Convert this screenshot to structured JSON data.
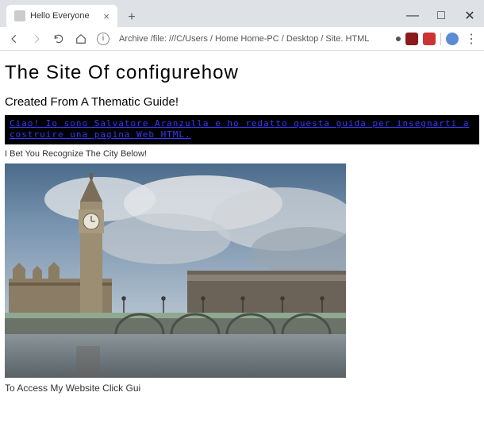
{
  "window": {
    "tab_title": "Hello Everyone",
    "minimize": "—",
    "maximize": "□",
    "close": "✕",
    "newtab": "+",
    "tab_close": "×"
  },
  "toolbar": {
    "info": "i",
    "address": "Archive /file: ///C/Users / Home Home-PC / Desktop / Site. HTML",
    "menu": "⋮"
  },
  "page": {
    "heading": "The Site Of  configurehow",
    "subheading": "Created From A Thematic Guide!",
    "blackbar_line1": "Ciao! Io sono Salvatore Aranzulla e ho redatto questa guida per insegnarti a",
    "blackbar_line2": "costruire una pagina Web HTML.",
    "caption": "I Bet You Recognize The City Below!",
    "image_alt": "London Big Ben and Westminster Bridge",
    "footer": "To Access My Website Click Gui"
  }
}
